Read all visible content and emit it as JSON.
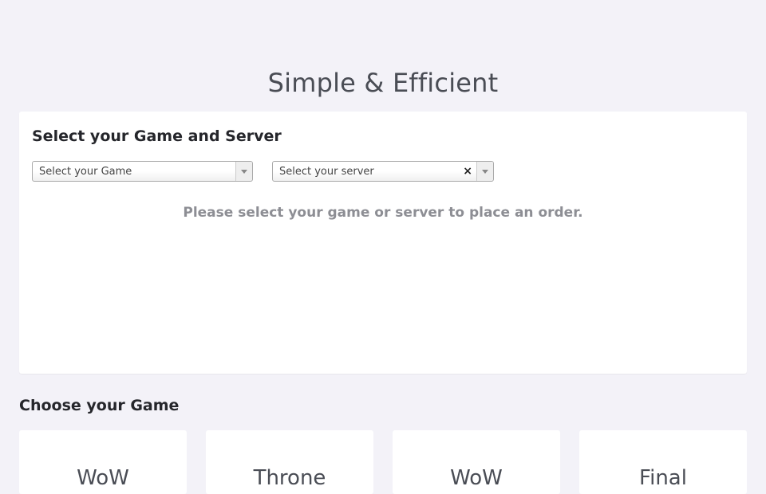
{
  "hero": {
    "title": "Simple & Efficient"
  },
  "order_panel": {
    "heading": "Select your Game and Server",
    "game_select": {
      "placeholder": "Select your Game"
    },
    "server_select": {
      "placeholder": "Select your server",
      "clear_glyph": "×"
    },
    "empty_message": "Please select your game or server to place an order."
  },
  "games_section": {
    "heading": "Choose your Game",
    "games": [
      {
        "name": "WoW"
      },
      {
        "name": "Throne"
      },
      {
        "name": "WoW"
      },
      {
        "name": "Final"
      }
    ]
  },
  "colors": {
    "background": "#f3f2f8",
    "card": "#ffffff",
    "heading_text": "#25262b",
    "muted_text": "#8d8e94"
  }
}
